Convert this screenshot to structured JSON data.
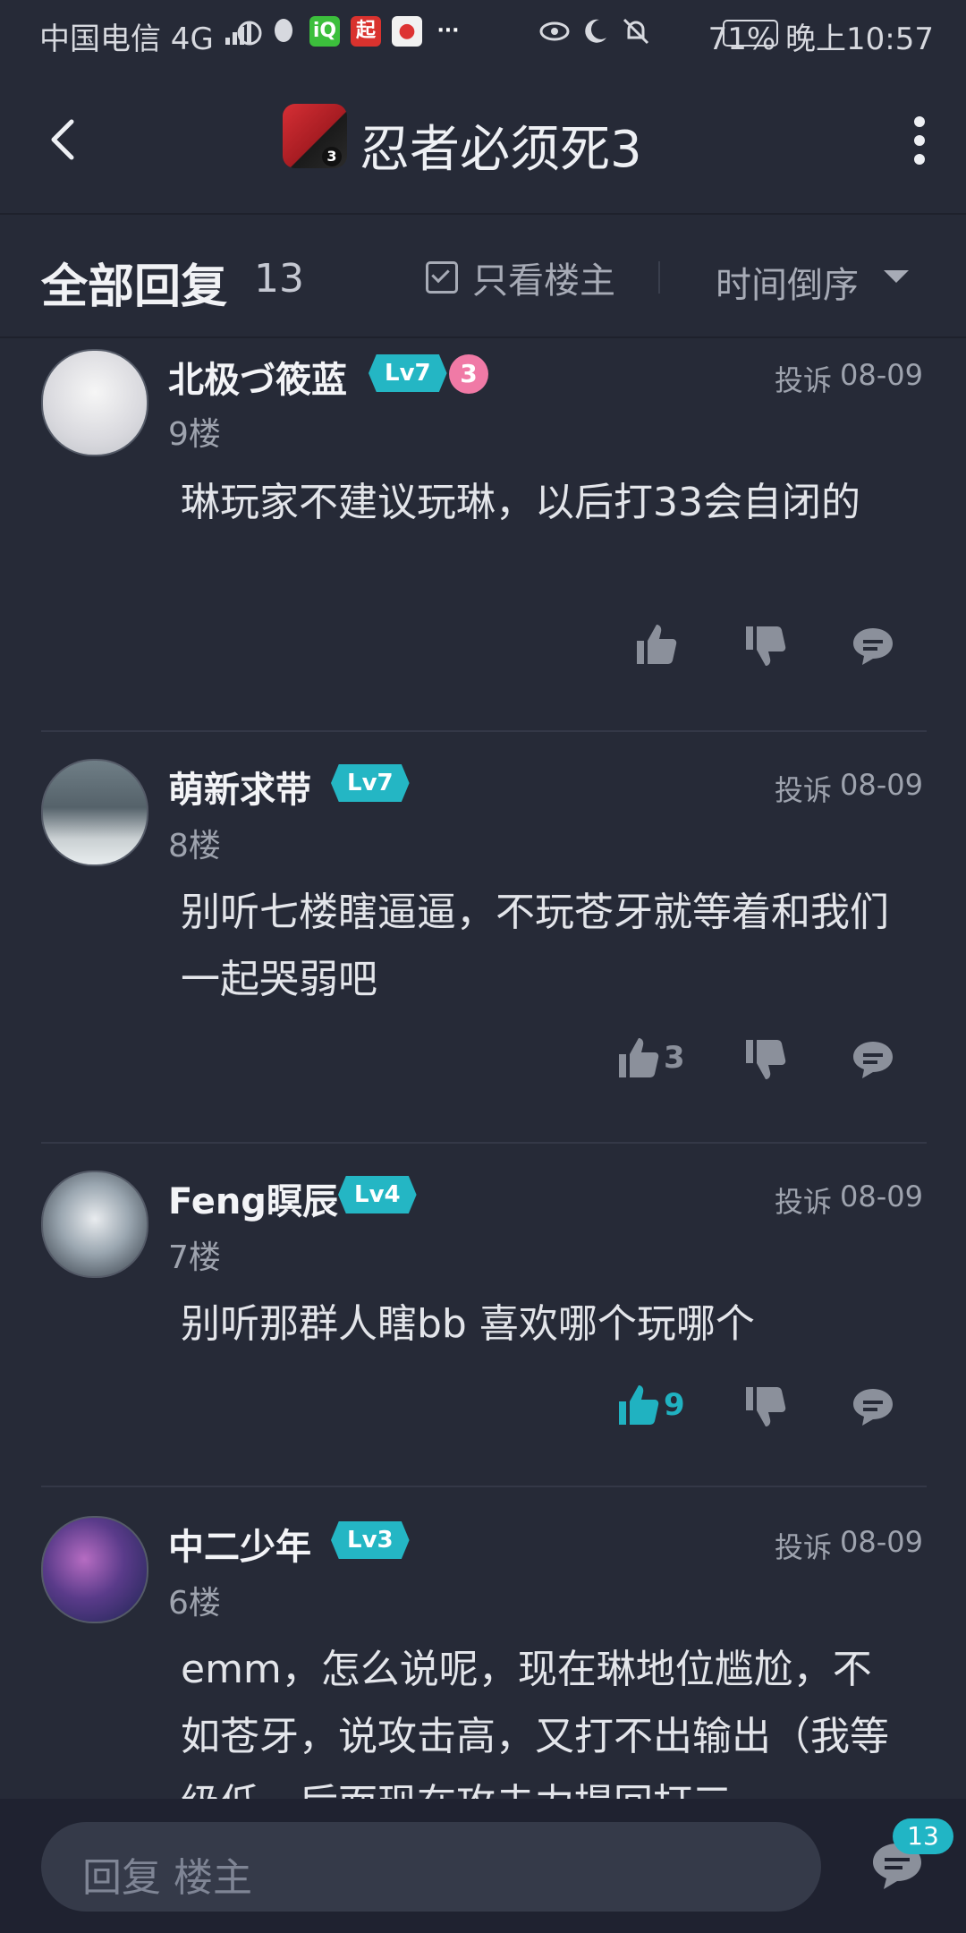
{
  "status_bar": {
    "left": "中国电信 4G",
    "right": "71%   晚上10:57",
    "icons": [
      "signal-icon",
      "timer-icon",
      "qq-icon",
      "iqiyi-icon",
      "qidian-icon",
      "map-icon",
      "more-icon",
      "eye-icon",
      "moon-icon",
      "mute-icon",
      "battery-icon"
    ]
  },
  "header": {
    "title": "忍者必须死3",
    "game_icon_number": "3"
  },
  "filters": {
    "all_label": "全部回复",
    "count": "13",
    "only_owner_label": "只看楼主",
    "sort_label": "时间倒序"
  },
  "posts": [
    {
      "username": "北极づ筱蓝",
      "level": "Lv7",
      "extra_badge": "3",
      "report": "投诉",
      "date": "08-09",
      "floor": "9楼",
      "content": "琳玩家不建议玩琳，以后打33会自闭的",
      "likes": ""
    },
    {
      "username": "萌新求带",
      "level": "Lv7",
      "report": "投诉",
      "date": "08-09",
      "floor": "8楼",
      "content": "别听七楼瞎逼逼，不玩苍牙就等着和我们一起哭弱吧",
      "likes": "3"
    },
    {
      "username": "Feng瞑辰",
      "level": "Lv4",
      "report": "投诉",
      "date": "08-09",
      "floor": "7楼",
      "content": "别听那群人瞎bb  喜欢哪个玩哪个",
      "likes": "9",
      "liked": true
    },
    {
      "username": "中二少年",
      "level": "Lv3",
      "report": "投诉",
      "date": "08-09",
      "floor": "6楼",
      "content": "emm，怎么说呢，现在琳地位尴尬，不如苍牙，说攻击高，又打不出输出（我等级低，后面现在攻击力提回打三",
      "likes": ""
    }
  ],
  "footer": {
    "reply_placeholder": "回复  楼主",
    "comment_count": "13"
  },
  "colors": {
    "background": "#262a37",
    "accent": "#20b2c1",
    "level_badge": "#24b6c4"
  }
}
